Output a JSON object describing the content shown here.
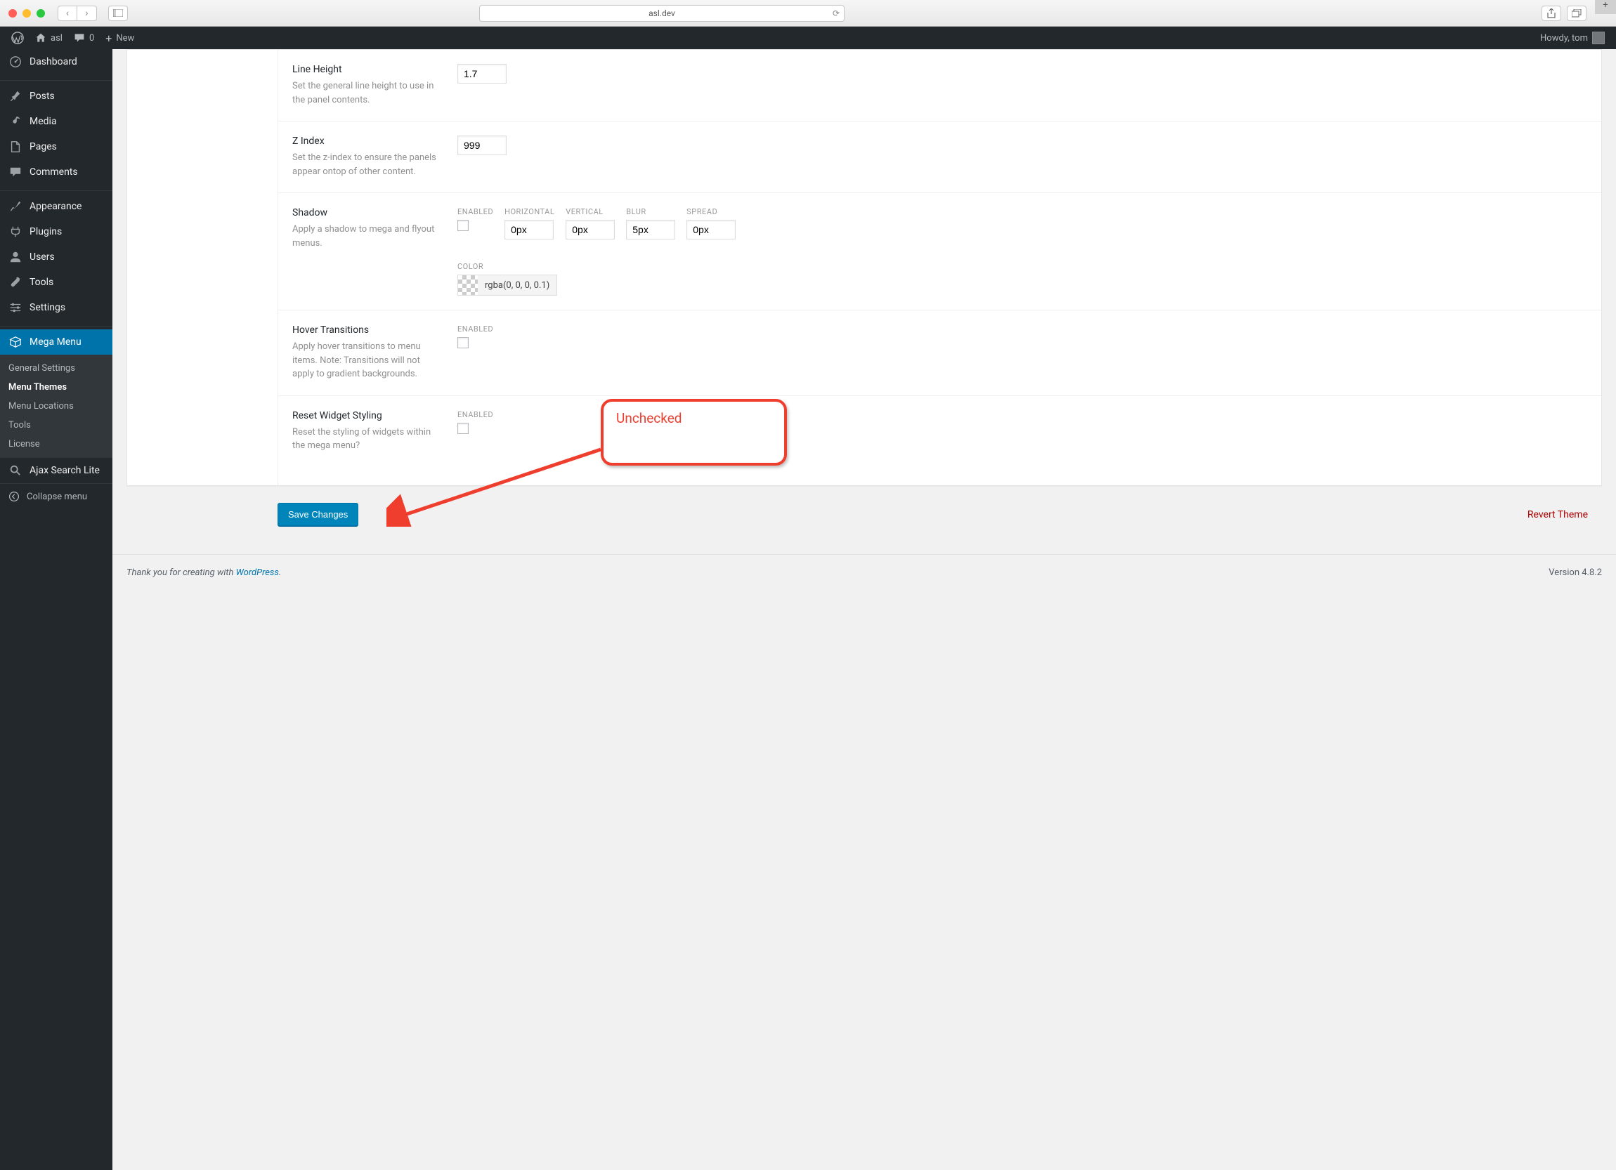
{
  "browser": {
    "url": "asl.dev"
  },
  "adminbar": {
    "site_name": "asl",
    "comments_count": "0",
    "new_label": "New",
    "howdy": "Howdy, tom"
  },
  "sidebar": {
    "items": [
      {
        "label": "Dashboard"
      },
      {
        "label": "Posts"
      },
      {
        "label": "Media"
      },
      {
        "label": "Pages"
      },
      {
        "label": "Comments"
      },
      {
        "label": "Appearance"
      },
      {
        "label": "Plugins"
      },
      {
        "label": "Users"
      },
      {
        "label": "Tools"
      },
      {
        "label": "Settings"
      },
      {
        "label": "Mega Menu"
      },
      {
        "label": "Ajax Search Lite"
      }
    ],
    "submenu": [
      {
        "label": "General Settings"
      },
      {
        "label": "Menu Themes"
      },
      {
        "label": "Menu Locations"
      },
      {
        "label": "Tools"
      },
      {
        "label": "License"
      }
    ],
    "collapse_label": "Collapse menu"
  },
  "settings": {
    "line_height": {
      "title": "Line Height",
      "desc": "Set the general line height to use in the panel contents.",
      "value": "1.7"
    },
    "z_index": {
      "title": "Z Index",
      "desc": "Set the z-index to ensure the panels appear ontop of other content.",
      "value": "999"
    },
    "shadow": {
      "title": "Shadow",
      "desc": "Apply a shadow to mega and flyout menus.",
      "labels": {
        "enabled": "ENABLED",
        "horizontal": "HORIZONTAL",
        "vertical": "VERTICAL",
        "blur": "BLUR",
        "spread": "SPREAD",
        "color": "COLOR"
      },
      "horizontal": "0px",
      "vertical": "0px",
      "blur": "5px",
      "spread": "0px",
      "color": "rgba(0, 0, 0, 0.1)"
    },
    "hover": {
      "title": "Hover Transitions",
      "desc": "Apply hover transitions to menu items. Note: Transitions will not apply to gradient backgrounds.",
      "enabled_label": "ENABLED"
    },
    "reset": {
      "title": "Reset Widget Styling",
      "desc": "Reset the styling of widgets within the mega menu?",
      "enabled_label": "ENABLED"
    }
  },
  "actions": {
    "save": "Save Changes",
    "revert": "Revert Theme"
  },
  "footer": {
    "text": "Thank you for creating with ",
    "link": "WordPress",
    "version": "Version 4.8.2"
  },
  "annotation": {
    "label": "Unchecked"
  }
}
